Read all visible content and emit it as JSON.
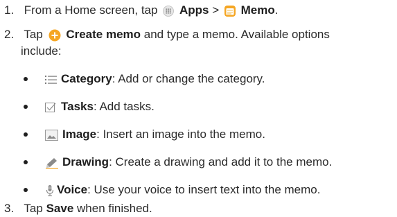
{
  "steps": [
    {
      "number": "1.",
      "prefix": "From a Home screen, tap",
      "apps_label": "Apps",
      "separator": ">",
      "memo_label": "Memo",
      "suffix": "."
    },
    {
      "number": "2.",
      "prefix": "Tap",
      "create_label": "Create memo",
      "suffix": "and type a memo. Available options",
      "continuation": "include:"
    },
    {
      "number": "3.",
      "prefix": "Tap",
      "save_label": "Save",
      "suffix": "when finished."
    }
  ],
  "options": [
    {
      "icon": "category-list-icon",
      "label": "Category",
      "desc": ": Add or change the category."
    },
    {
      "icon": "tasks-checkbox-icon",
      "label": "Tasks",
      "desc": ": Add tasks."
    },
    {
      "icon": "image-icon",
      "label": "Image",
      "desc": ": Insert an image into the memo."
    },
    {
      "icon": "drawing-pen-icon",
      "label": "Drawing",
      "desc": ": Create a drawing and add it to the memo."
    },
    {
      "icon": "voice-mic-icon",
      "label": "Voice",
      "desc": ": Use your voice to insert text into the memo."
    }
  ],
  "colors": {
    "create_icon": "#f5a623",
    "memo_icon": "#f5a623",
    "icon_gray": "#7a7a7a"
  }
}
